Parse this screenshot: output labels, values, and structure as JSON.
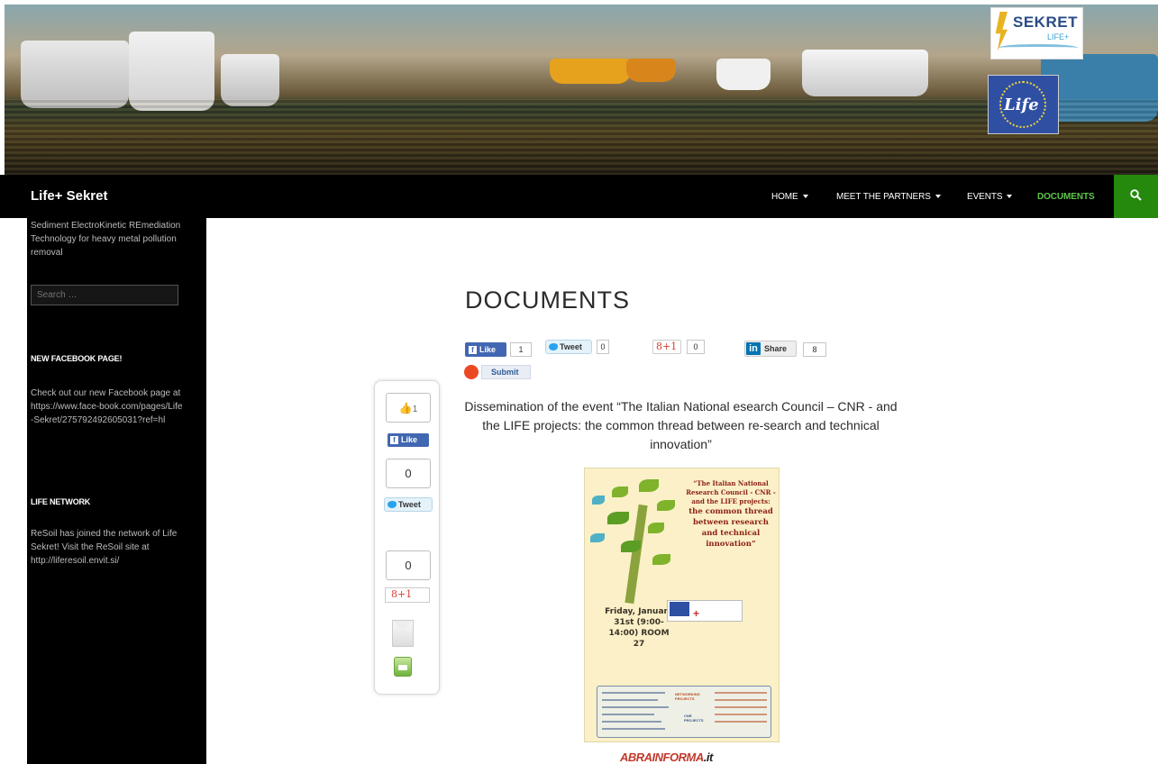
{
  "logos": {
    "sekret": "SEKRET",
    "sekret_sub": "LIFE+",
    "life": "Life"
  },
  "header": {
    "site_title": "Life+ Sekret"
  },
  "nav": {
    "items": [
      {
        "label": "HOME",
        "dropdown": true
      },
      {
        "label": "MEET THE PARTNERS",
        "dropdown": true
      },
      {
        "label": "EVENTS",
        "dropdown": true
      },
      {
        "label": "DOCUMENTS",
        "dropdown": false,
        "active": true
      }
    ],
    "search_icon": "search-icon"
  },
  "sidebar": {
    "description": "Sediment ElectroKinetic REmediation Technology for heavy metal pollution removal",
    "search_placeholder": "Search …",
    "widgets": [
      {
        "title": "NEW FACEBOOK PAGE!",
        "text": "Check out our new Facebook page at https://www.face-book.com/pages/Life-Sekret/275792492605031?ref=hl"
      },
      {
        "title": "LIFE NETWORK",
        "text": "ReSoil has joined the network of Life Sekret! Visit the ReSoil site at http://liferesoil.envit.si/"
      }
    ]
  },
  "content": {
    "title": "DOCUMENTS",
    "share": {
      "fb_like": "Like",
      "fb_count": "1",
      "tweet": "Tweet",
      "tweet_count": "0",
      "gplus": "8+1",
      "gplus_count": "0",
      "linkedin": "Share",
      "linkedin_count": "8",
      "stumble": "Submit"
    },
    "intro": "Dissemination of the event “The Italian National esearch Council – CNR - and the LIFE projects: the common thread between re-search and technical innovation”"
  },
  "float_share": {
    "like_count": "1",
    "like_label": "Like",
    "tweet_count": "0",
    "tweet_label": "Tweet",
    "gplus_count": "0",
    "gplus_label": "8+1"
  },
  "poster": {
    "title_small": "“The Italian National Research Council - CNR - and the LIFE projects:",
    "title_big": "the common thread between research and technical innovation”",
    "date": "Friday, January 31st (9:00-14:00) ROOM 27",
    "networking_label": "NETWORKING PROJECTS",
    "cnr_label": "CNR PROJECTS"
  },
  "bottom_logo": {
    "a": "A",
    "brand": "BRAINFORMA",
    "suffix": ".it"
  }
}
